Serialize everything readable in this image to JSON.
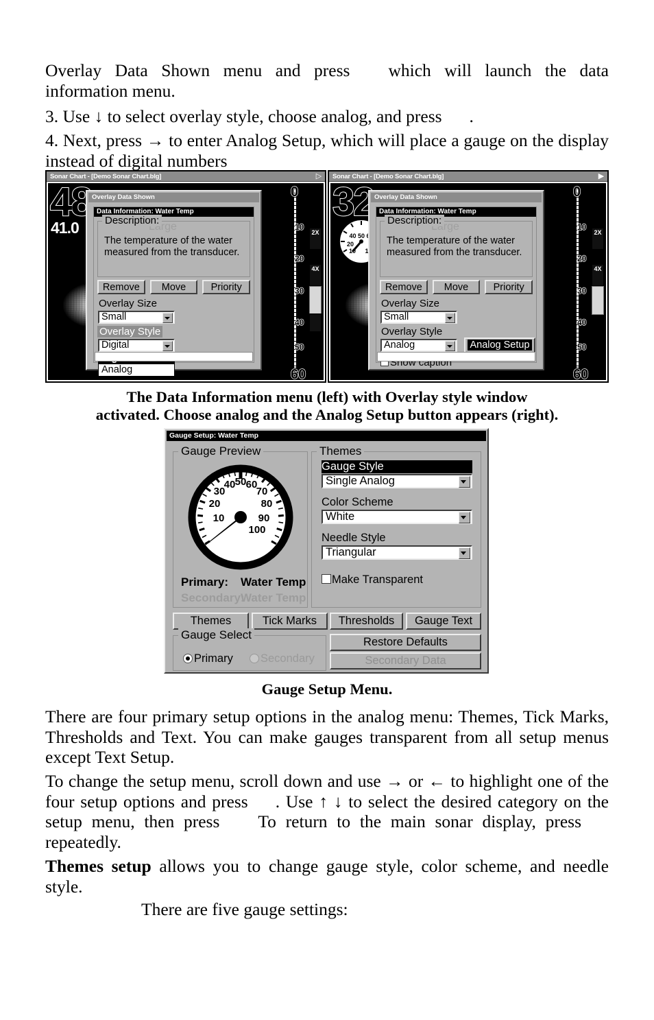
{
  "document": {
    "paragraphs": {
      "p1_a": "Overlay Data Shown menu and press",
      "p1_b": "which will launch the data information menu.",
      "p2": "3. Use ↓ to select overlay style, choose analog, and press",
      "p2_end": ".",
      "p3": "4. Next, press → to enter Analog Setup, which will place a gauge on the display instead of digital numbers",
      "p4_a": "There are four primary setup options in the analog menu: Themes, Tick Marks, Thresholds and Text. You can make gauges transparent from all setup menus except Text Setup.",
      "p5_a": "To change the setup menu, scroll down and use → or ← to highlight one of the four setup options and press",
      "p5_b": ". Use ↑ ↓ to select the desired category on the setup menu, then press",
      "p5_c": "To return to the main sonar display, press",
      "p5_d": "repeatedly.",
      "p6_bold": "Themes setup",
      "p6_rest": " allows you to change gauge style, color scheme, and needle style.",
      "p7": "There are five gauge settings:"
    },
    "captions": {
      "figure1_line1": "The Data Information menu (left) with Overlay style window",
      "figure1_line2": "activated. Choose analog and the Analog Setup button appears (right).",
      "figure2": "Gauge Setup Menu."
    }
  },
  "sonar_left": {
    "title": "Sonar Chart - [Demo Sonar Chart.blg]",
    "depth_reading": "48.",
    "temp_reading": "41.0",
    "depth_scale": [
      "0",
      "10",
      "20",
      "30",
      "40",
      "50",
      "60"
    ],
    "zoom_bars": [
      "2X",
      "4X"
    ],
    "menu": {
      "title": "Overlay Data Shown",
      "data_info_title": "Data Information: Water Temp",
      "description_legend": "Description:",
      "description_text": "The temperature of the water measured from the transducer.",
      "ghost_large": "Large",
      "buttons": [
        "Remove",
        "Move",
        "Priority"
      ],
      "overlay_size_label": "Overlay Size",
      "overlay_size_value": "Small",
      "overlay_style_label": "Overlay Style",
      "overlay_style_value": "Digital",
      "overlay_style_options": [
        "Digital",
        "Analog"
      ],
      "overlay_style_selected": "Digital"
    }
  },
  "sonar_right": {
    "title": "Sonar Chart - [Demo Sonar Chart.blg]",
    "depth_reading": "32.",
    "depth_scale": [
      "0",
      "10",
      "20",
      "30",
      "40",
      "50",
      "60"
    ],
    "zoom_bars": [
      "2X",
      "4X"
    ],
    "menu": {
      "title": "Overlay Data Shown",
      "data_info_title": "Data Information: Water Temp",
      "description_legend": "Description:",
      "description_text": "The temperature of the water measured from the transducer.",
      "ghost_large": "Large",
      "buttons": [
        "Remove",
        "Move",
        "Priority"
      ],
      "overlay_size_label": "Overlay Size",
      "overlay_size_value": "Small",
      "overlay_style_label": "Overlay Style",
      "overlay_style_value": "Analog",
      "analog_setup_button": "Analog Setup",
      "show_caption_label": "Show caption",
      "show_caption_checked": false
    }
  },
  "gauge_setup": {
    "title": "Gauge Setup: Water Temp",
    "preview": {
      "legend": "Gauge Preview",
      "primary_label": "Primary:",
      "primary_value": "Water Temp",
      "secondary_label": "Secondary:",
      "secondary_value": "Water Temp"
    },
    "themes": {
      "legend": "Themes",
      "gauge_style_label": "Gauge Style",
      "gauge_style_value": "Single Analog",
      "color_scheme_label": "Color Scheme",
      "color_scheme_value": "White",
      "needle_style_label": "Needle Style",
      "needle_style_value": "Triangular",
      "make_transparent_label": "Make Transparent",
      "make_transparent_checked": false
    },
    "tab_buttons": [
      "Themes",
      "Tick Marks",
      "Thresholds",
      "Gauge Text"
    ],
    "gauge_select": {
      "legend": "Gauge Select",
      "primary_label": "Primary",
      "secondary_label": "Secondary",
      "selected": "Primary"
    },
    "restore_defaults_label": "Restore Defaults",
    "secondary_data_label": "Secondary Data"
  },
  "chart_data": {
    "type": "gauge",
    "title": "Gauge Preview — Water Temp",
    "tick_labels": [
      "10",
      "20",
      "30",
      "40",
      "50",
      "60",
      "70",
      "80",
      "90",
      "100"
    ],
    "min": 0,
    "max": 110,
    "value": 0,
    "needle_style": "Triangular",
    "color_scheme": "White",
    "gauge_style": "Single Analog"
  }
}
